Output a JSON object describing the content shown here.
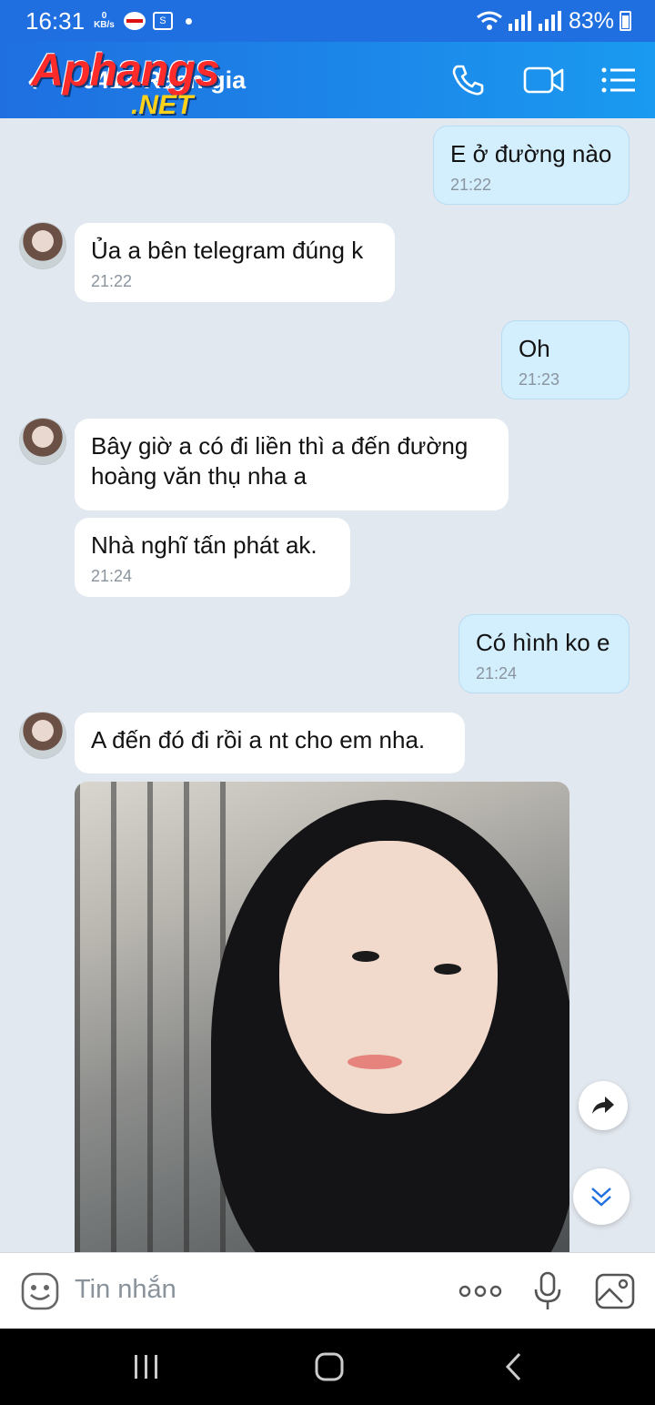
{
  "status_bar": {
    "time": "16:31",
    "net_speed_value": "0",
    "net_speed_unit": "KB/s",
    "battery": "83%"
  },
  "header": {
    "title": "0413 Rach gia",
    "watermark_top": "Aphang",
    "watermark_suffix": "s",
    "watermark_bottom": ".NET",
    "icons": [
      "back-icon",
      "phone-icon",
      "video-call-icon",
      "menu-icon"
    ]
  },
  "messages": [
    {
      "side": "out",
      "text": "E ở đường nào",
      "time": "21:22"
    },
    {
      "side": "in",
      "text": "Ủa a bên telegram đúng k",
      "time": "21:22"
    },
    {
      "side": "out",
      "text": "Oh",
      "time": "21:23"
    },
    {
      "side": "in",
      "text_line1": "Bây giờ a có đi liền thì a đến đường",
      "text_line2": "hoàng văn thụ nha a"
    },
    {
      "side": "in",
      "text": "Nhà nghĩ tấn phát ak.",
      "time": "21:24"
    },
    {
      "side": "out",
      "text": "Có hình ko e",
      "time": "21:24"
    },
    {
      "side": "in",
      "text": "A đến đó đi rồi a nt cho em nha."
    }
  ],
  "composer": {
    "placeholder": "Tin nhắn",
    "icons": [
      "emoji-icon",
      "more-icon",
      "microphone-icon",
      "gallery-icon"
    ]
  },
  "floating": [
    "share-forward-icon",
    "scroll-down-icon"
  ],
  "colors": {
    "header_start": "#1f6fe0",
    "header_end": "#1a9af0",
    "outgoing_bubble": "#d3eefd",
    "chat_background": "#e2e8ef"
  }
}
